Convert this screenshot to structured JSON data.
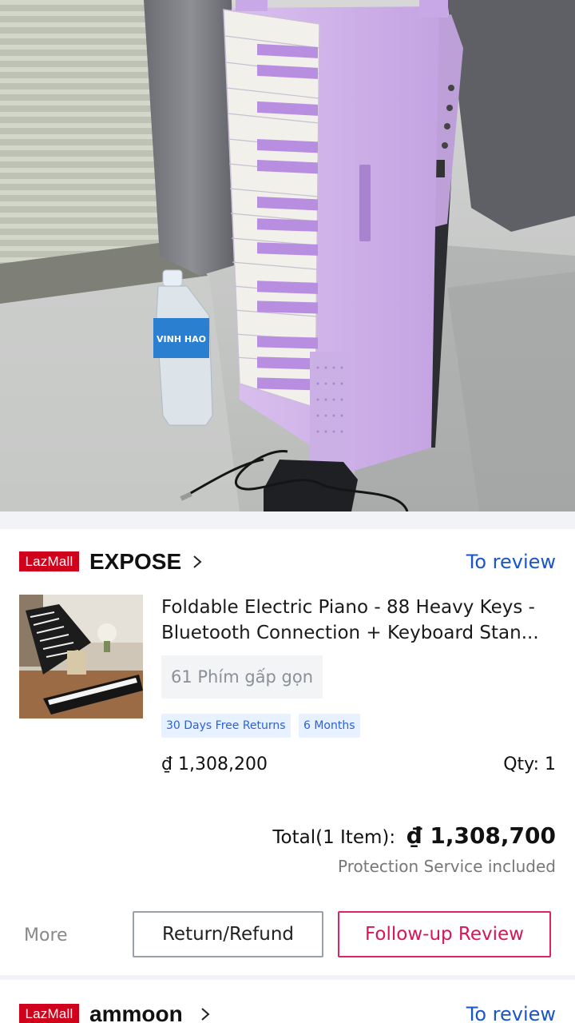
{
  "orders": [
    {
      "badge": "LazMall",
      "shop_name": "EXPOSE",
      "action_link": "To review",
      "product": {
        "title_line1": "Foldable Electric Piano - 88 Heavy Keys -",
        "title_line2": "Bluetooth Connection + Keyboard Stan...",
        "variant": "61 Phím gấp gọn",
        "tags": [
          "30 Days Free Returns",
          "6 Months"
        ],
        "price": "₫ 1,308,200",
        "qty": "Qty: 1"
      },
      "total_label": "Total(1 Item):",
      "total_value": "₫ 1,308,700",
      "protection_note": "Protection Service included",
      "more_label": "More",
      "buttons": {
        "return_refund": "Return/Refund",
        "follow_up_review": "Follow-up Review"
      }
    },
    {
      "badge": "LazMall",
      "shop_name": "ammoon",
      "action_link": "To review"
    }
  ],
  "photo_label": "VINH HAO",
  "colors": {
    "lazmall_red": "#d0011b",
    "link_blue": "#1a55c9",
    "follow_pink": "#e0245e",
    "tag_bg": "#e8f1ff",
    "piano_purple": "#c9a8e6"
  },
  "icons": [
    "chevron-right-icon"
  ]
}
